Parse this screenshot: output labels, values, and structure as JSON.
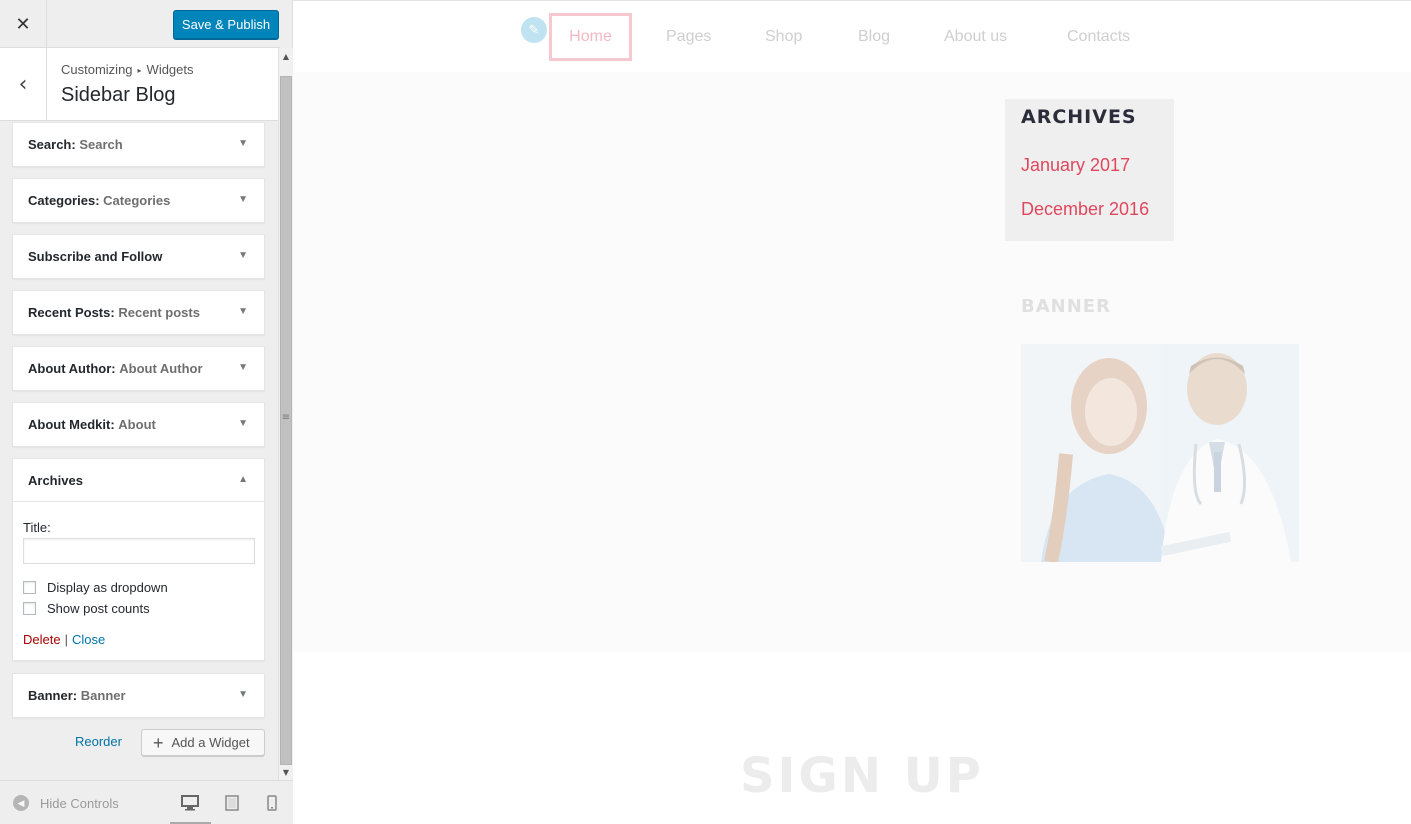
{
  "header": {
    "close_icon": "close-icon",
    "publish_label": "Save & Publish",
    "publish_color": "#0085ba"
  },
  "section": {
    "crumb_1": "Customizing",
    "crumb_2": "Widgets",
    "title": "Sidebar Blog"
  },
  "widgets": [
    {
      "name": "Search",
      "subtitle": "Search",
      "state": "collapsed"
    },
    {
      "name": "Categories",
      "subtitle": "Categories",
      "state": "collapsed"
    },
    {
      "name": "Subscribe and Follow",
      "subtitle": "",
      "state": "collapsed"
    },
    {
      "name": "Recent Posts",
      "subtitle": "Recent posts",
      "state": "collapsed"
    },
    {
      "name": "About Author",
      "subtitle": "About Author",
      "state": "collapsed"
    },
    {
      "name": "About Medkit",
      "subtitle": "About",
      "state": "collapsed"
    },
    {
      "name": "Archives",
      "subtitle": "",
      "state": "expanded"
    },
    {
      "name": "Banner",
      "subtitle": "Banner",
      "state": "collapsed"
    }
  ],
  "archives_form": {
    "title_label": "Title:",
    "title_value": "",
    "dropdown_label": "Display as dropdown",
    "dropdown_checked": false,
    "counts_label": "Show post counts",
    "counts_checked": false,
    "delete_label": "Delete",
    "separator": "|",
    "close_label": "Close"
  },
  "bottom": {
    "reorder_label": "Reorder",
    "add_widget_label": "Add a Widget"
  },
  "footer": {
    "hide_controls_label": "Hide Controls",
    "devices": [
      "desktop",
      "tablet",
      "mobile"
    ],
    "active_device": "desktop"
  },
  "preview": {
    "nav": [
      "Home",
      "Pages",
      "Shop",
      "Blog",
      "About us",
      "Contacts"
    ],
    "active_nav": "Home",
    "archives_title": "ARCHIVES",
    "archive_links": [
      "January 2017",
      "December 2016"
    ],
    "banner_title": "BANNER",
    "signup_title": "SIGN UP",
    "link_color": "#e0475d"
  }
}
